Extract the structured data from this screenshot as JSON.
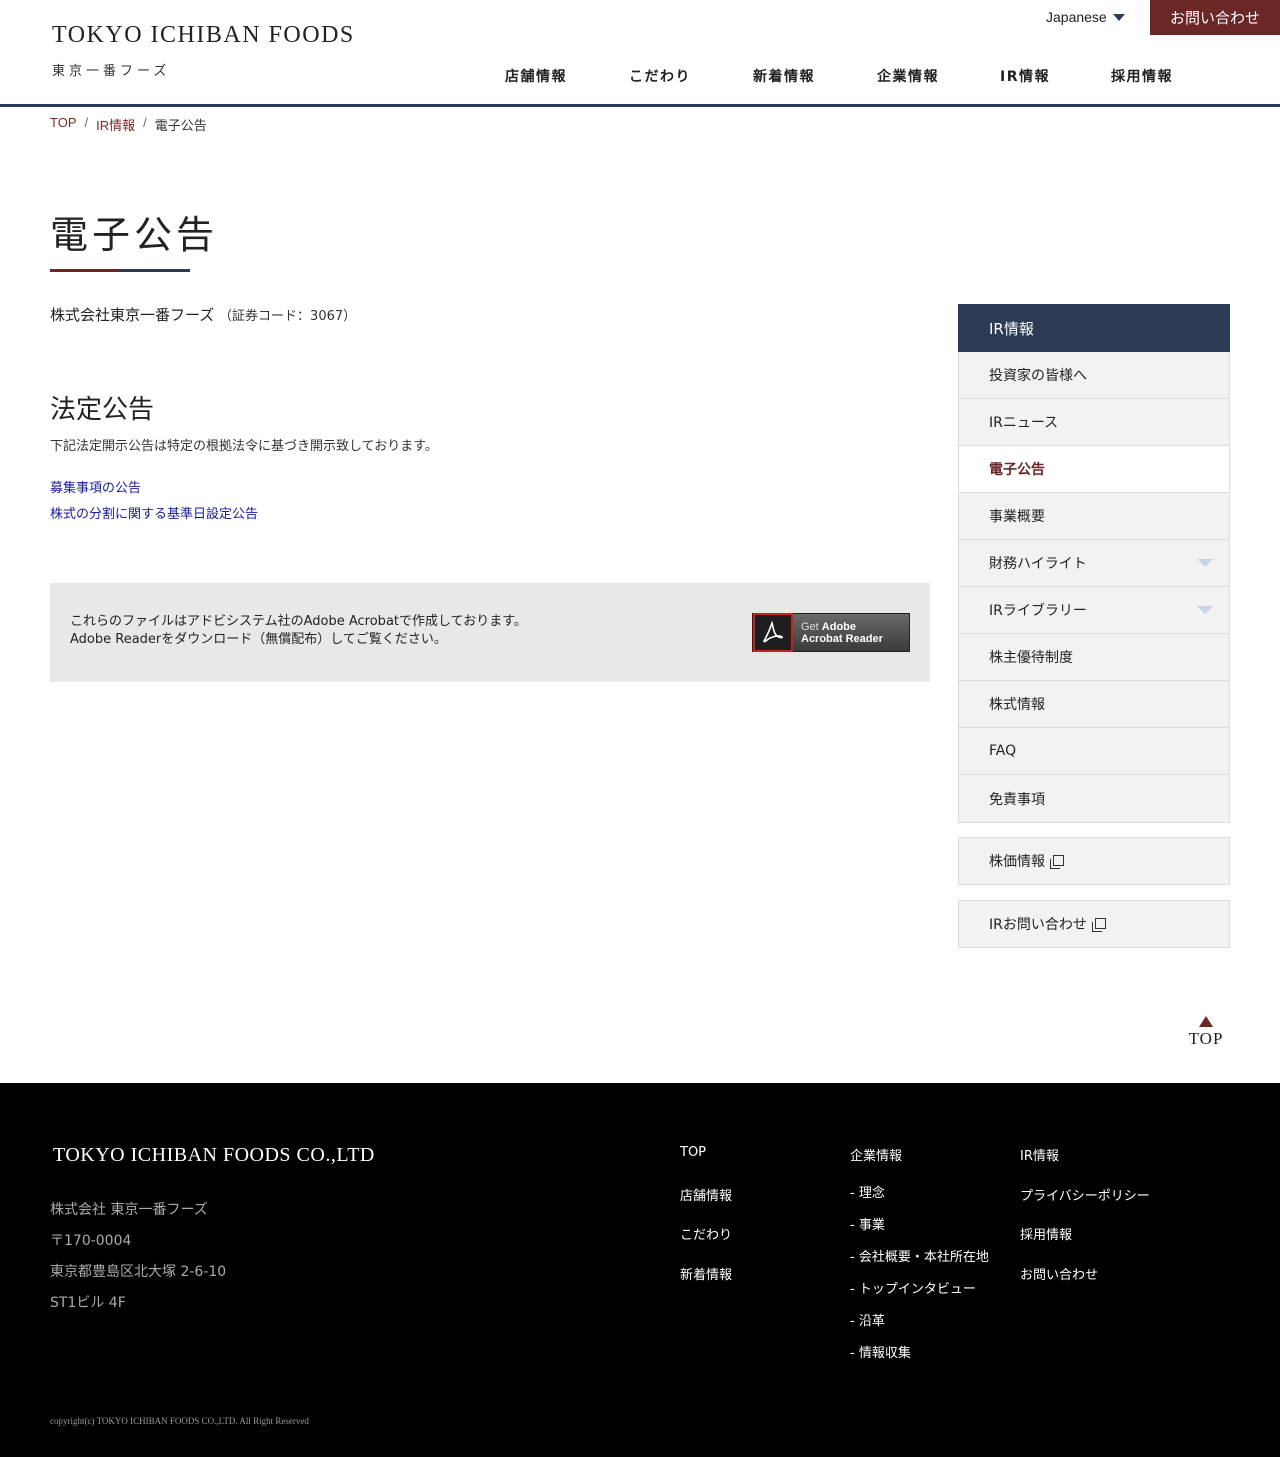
{
  "header": {
    "logo_en": "TOKYO ICHIBAN FOODS",
    "logo_jp": "東京一番フーズ",
    "language": "Japanese",
    "contact_label": "お問い合わせ",
    "nav": [
      "店舗情報",
      "こだわり",
      "新着情報",
      "企業情報",
      "IR情報",
      "採用情報"
    ]
  },
  "breadcrumb": {
    "top": "TOP",
    "ir": "IR情報",
    "current": "電子公告",
    "separator": "/"
  },
  "page": {
    "title": "電子公告",
    "company": "株式会社東京一番フーズ",
    "code": "（証券コード：3067）",
    "section_title": "法定公告",
    "section_desc": "下記法定開示公告は特定の根拠法令に基づき開示致しております。",
    "links": [
      "募集事項の公告",
      "株式の分割に関する基準日設定公告"
    ],
    "pdf_note_line1": "これらのファイルはアドビシステム社のAdobe Acrobatで作成しております。",
    "pdf_note_line2": "Adobe Readerをダウンロード（無償配布）してご覧ください。",
    "adobe_get": "Get",
    "adobe_brand": "Adobe",
    "adobe_product": "Acrobat Reader"
  },
  "sidebar": {
    "heading": "IR情報",
    "items": [
      {
        "label": "投資家の皆様へ"
      },
      {
        "label": "IRニュース"
      },
      {
        "label": "電子公告",
        "active": true
      },
      {
        "label": "事業概要"
      },
      {
        "label": "財務ハイライト",
        "dropdown": true
      },
      {
        "label": "IRライブラリー",
        "dropdown": true
      },
      {
        "label": "株主優待制度"
      },
      {
        "label": "株式情報"
      },
      {
        "label": "FAQ"
      },
      {
        "label": "免責事項"
      }
    ],
    "stock_price": "株価情報",
    "ir_contact": "IRお問い合わせ"
  },
  "to_top": "TOP",
  "footer": {
    "logo": "TOKYO ICHIBAN FOODS CO.,LTD",
    "company": "株式会社 東京一番フーズ",
    "zip": "〒170-0004",
    "address": "東京都豊島区北大塚 2-6-10",
    "building": "ST1ビル 4F",
    "col1": [
      "TOP",
      "店舗情報",
      "こだわり",
      "新着情報"
    ],
    "col2_title": "企業情報",
    "col2": [
      "- 理念",
      "- 事業",
      "- 会社概要・本社所在地",
      "- トップインタビュー",
      "- 沿革",
      "- 情報収集"
    ],
    "col3": [
      "IR情報",
      "プライバシーポリシー",
      "採用情報",
      "お問い合わせ"
    ],
    "copyright": "copyright(c) TOKYO ICHIBAN FOODS CO.,LTD. All Right Reserved"
  },
  "colors": {
    "accent_red": "#6b2626",
    "navy": "#2b3a55",
    "link_blue": "#1a1aa0"
  }
}
